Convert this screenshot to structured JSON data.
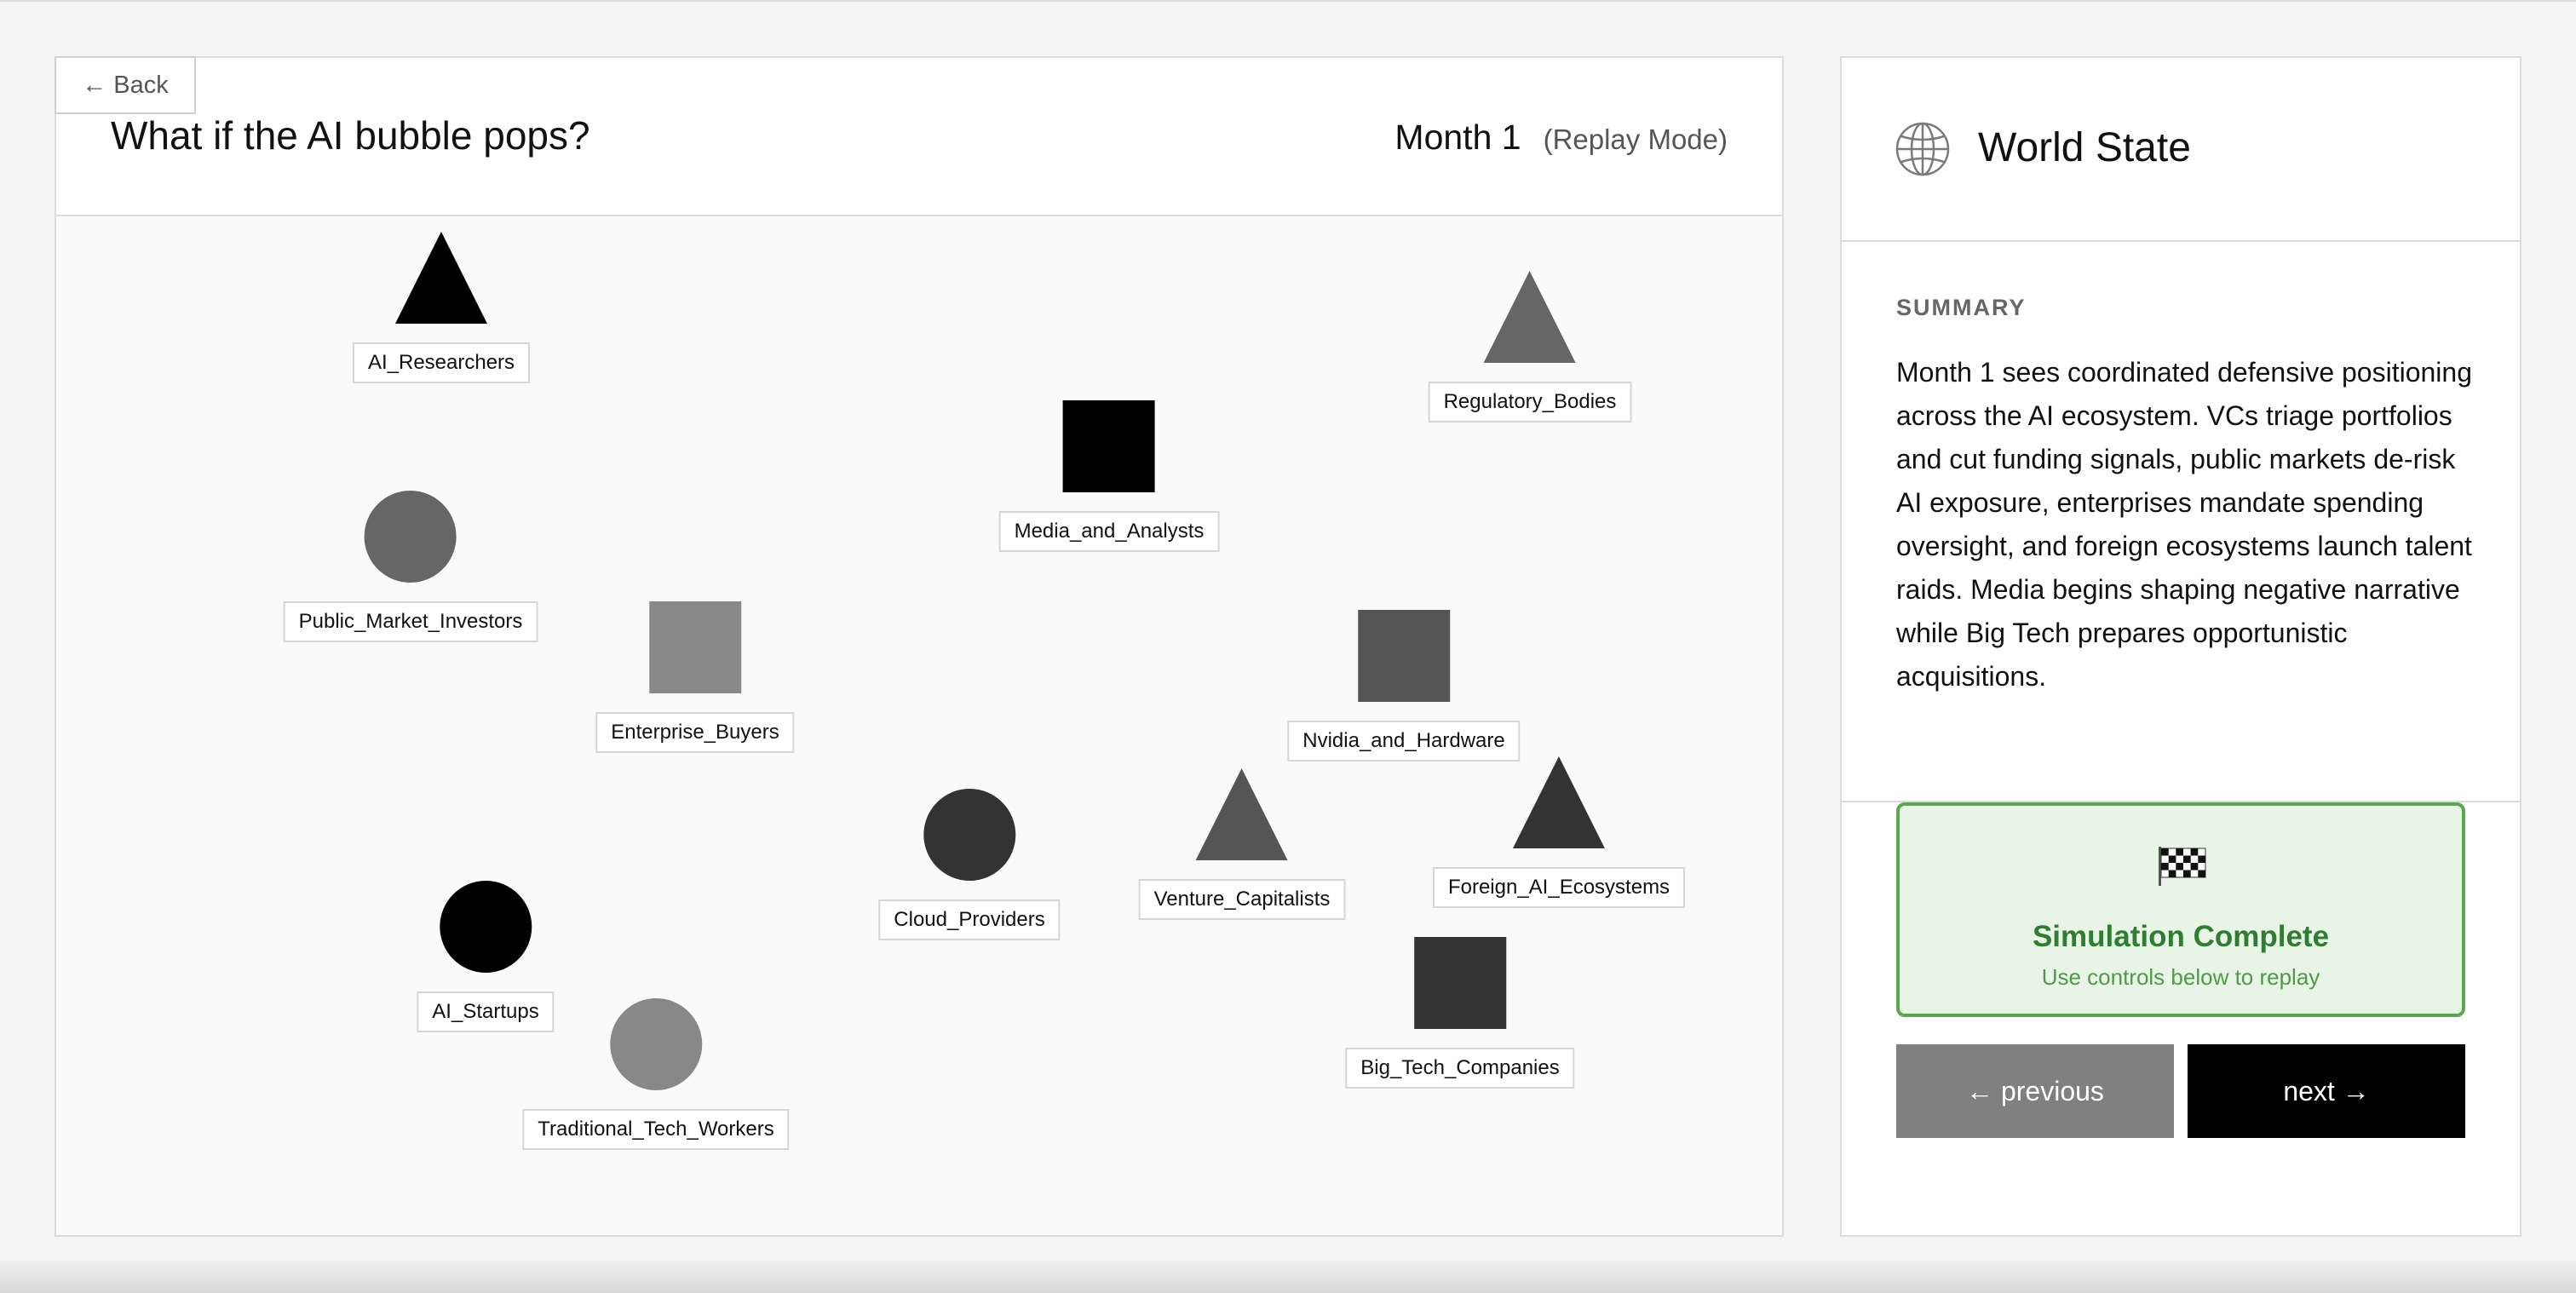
{
  "header": {
    "back_label": "← Back",
    "title": "What if the AI bubble pops?",
    "month": "Month 1",
    "mode": "(Replay Mode)"
  },
  "agents": [
    {
      "name": "AI_Researchers",
      "shape": "triangle",
      "color": "#000000"
    },
    {
      "name": "Regulatory_Bodies",
      "shape": "triangle",
      "color": "#666666"
    },
    {
      "name": "Media_and_Analysts",
      "shape": "square",
      "color": "#000000"
    },
    {
      "name": "Public_Market_Investors",
      "shape": "circle",
      "color": "#666666"
    },
    {
      "name": "Enterprise_Buyers",
      "shape": "square",
      "color": "#888888"
    },
    {
      "name": "Nvidia_and_Hardware",
      "shape": "square",
      "color": "#555555"
    },
    {
      "name": "Cloud_Providers",
      "shape": "circle",
      "color": "#333333"
    },
    {
      "name": "Venture_Capitalists",
      "shape": "triangle",
      "color": "#555555"
    },
    {
      "name": "Foreign_AI_Ecosystems",
      "shape": "triangle",
      "color": "#333333"
    },
    {
      "name": "AI_Startups",
      "shape": "circle",
      "color": "#000000"
    },
    {
      "name": "Big_Tech_Companies",
      "shape": "square",
      "color": "#333333"
    },
    {
      "name": "Traditional_Tech_Workers",
      "shape": "circle",
      "color": "#888888"
    }
  ],
  "side": {
    "title": "World State",
    "icon": "globe-icon",
    "summary_label": "SUMMARY",
    "summary_text": "Month 1 sees coordinated defensive positioning across the AI ecosystem. VCs triage portfolios and cut funding signals, public markets de-risk AI exposure, enterprises mandate spending oversight, and foreign ecosystems launch talent raids. Media begins shaping negative narrative while Big Tech prepares opportunistic acquisitions.",
    "complete_icon": "checkered-flag-icon",
    "complete_title": "Simulation Complete",
    "complete_sub": "Use controls below to replay",
    "prev_label": "← previous",
    "next_label": "next →"
  },
  "colors": {
    "success_green": "#2e7d32",
    "success_bg": "#e8f4e6",
    "prev_button": "#808080",
    "next_button": "#000000"
  }
}
